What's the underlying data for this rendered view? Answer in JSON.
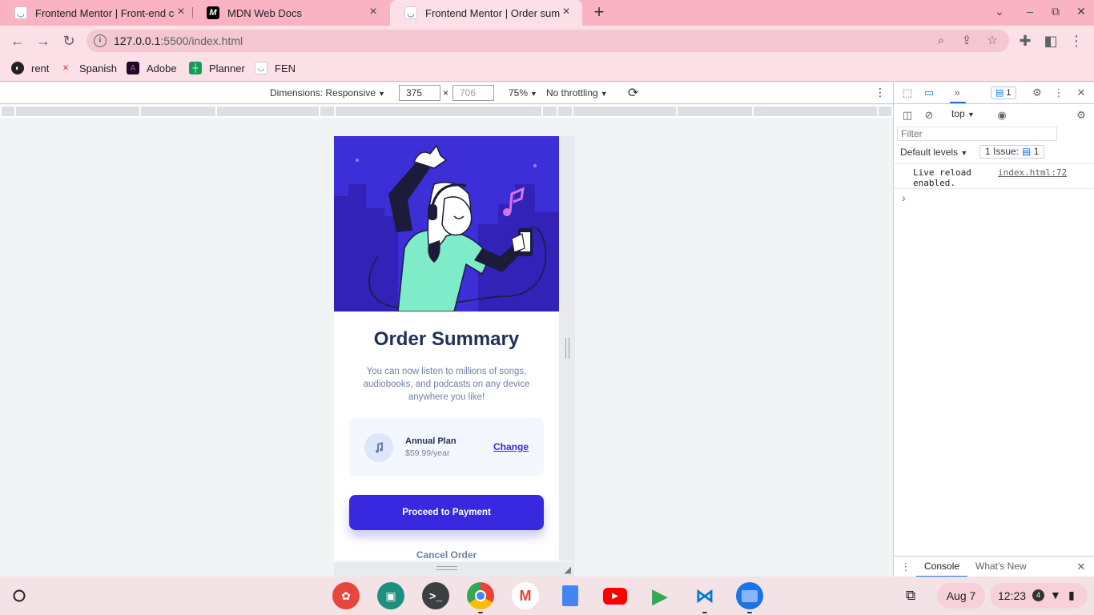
{
  "browser": {
    "tabs": [
      {
        "title": "Frontend Mentor | Front-end cod",
        "favicon": "frontend-mentor-icon",
        "active": false
      },
      {
        "title": "MDN Web Docs",
        "favicon": "mdn-icon",
        "active": false
      },
      {
        "title": "Frontend Mentor | Order summa",
        "favicon": "frontend-mentor-icon",
        "active": true
      }
    ],
    "close_glyph": "×",
    "new_tab_glyph": "+",
    "url": {
      "host": "127.0.0.1",
      "rest": ":5500/index.html"
    },
    "bookmarks": [
      {
        "label": "rent",
        "icon": "globe-icon"
      },
      {
        "label": "Spanish",
        "icon": "spanish-icon"
      },
      {
        "label": "Adobe",
        "icon": "adobe-icon"
      },
      {
        "label": "Planner",
        "icon": "planner-icon"
      },
      {
        "label": "FEN",
        "icon": "frontend-mentor-icon"
      }
    ]
  },
  "device_toolbar": {
    "dimensions_label": "Dimensions: Responsive",
    "width": "375",
    "height_placeholder": "706",
    "times": "×",
    "zoom": "75%",
    "throttling": "No throttling"
  },
  "page": {
    "title": "Order Summary",
    "description": "You can now listen to millions of songs, audiobooks, and podcasts on any device anywhere you like!",
    "plan_name": "Annual Plan",
    "plan_price": "$59.99/year",
    "change_label": "Change",
    "pay_label": "Proceed to Payment",
    "cancel_label": "Cancel Order",
    "colors": {
      "hero": "#3d2fd8",
      "primary": "#3829e0",
      "title": "#1f2f56",
      "muted": "#717fa6",
      "plan_bg": "#f5f7ff"
    }
  },
  "devtools": {
    "issues_badge_count": "1",
    "context": "top",
    "filter_placeholder": "Filter",
    "levels": "Default levels",
    "issues_label": "1 Issue:",
    "issues_count": "1",
    "log_message": "Live reload enabled.",
    "log_source": "index.html:72",
    "prompt": "›",
    "drawer_tabs": [
      "Console",
      "What's New"
    ]
  },
  "shelf": {
    "apps": [
      "adobe-express-icon",
      "classroom-icon",
      "terminal-icon",
      "chrome-icon",
      "gmail-icon",
      "docs-icon",
      "youtube-icon",
      "play-store-icon",
      "vscode-icon",
      "files-icon"
    ],
    "date": "Aug 7",
    "time": "12:23",
    "notification_count": "4"
  }
}
